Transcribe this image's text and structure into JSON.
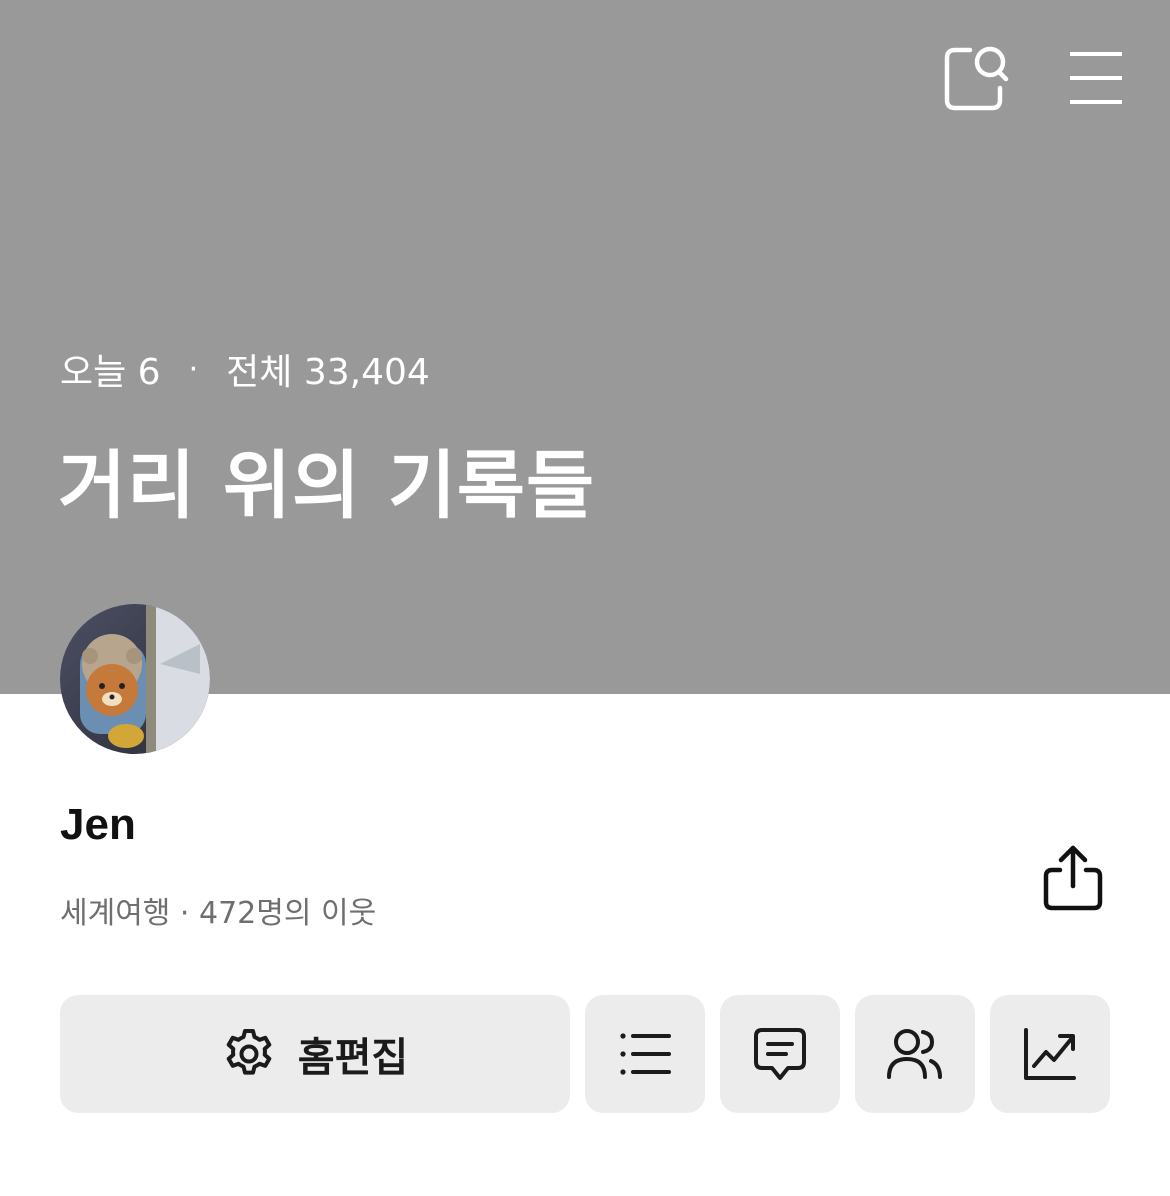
{
  "header": {
    "icons": [
      "search-icon",
      "menu-icon"
    ],
    "bg_color": "#999999"
  },
  "stats": {
    "today_label": "오늘 6",
    "separator": "·",
    "total_label": "전체 33,404"
  },
  "blog": {
    "title": "거리 위의 기록들"
  },
  "profile": {
    "name": "Jen",
    "meta": "세계여행 · 472명의 이웃"
  },
  "actions": {
    "edit_home_label": "홈편집",
    "buttons": [
      "gear-icon",
      "list-icon",
      "comment-icon",
      "neighbors-icon",
      "stats-chart-icon"
    ],
    "button_bg": "#ececec"
  }
}
